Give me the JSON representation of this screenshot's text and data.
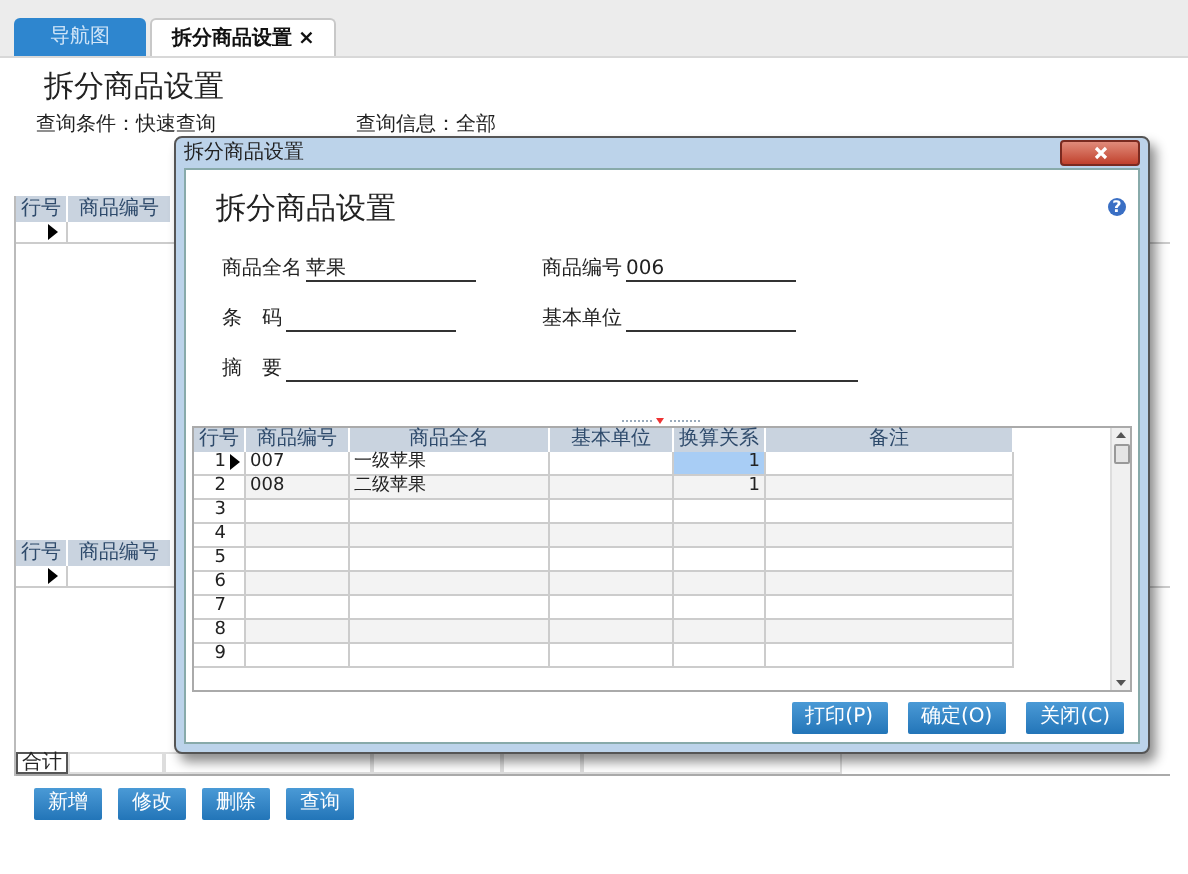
{
  "tabs": [
    {
      "label": "导航图",
      "selected": false
    },
    {
      "label": "拆分商品设置",
      "selected": true,
      "close_glyph": "×"
    }
  ],
  "page_title": "拆分商品设置",
  "query": [
    {
      "label": "查询条件：",
      "value": "快速查询"
    },
    {
      "label": "查询信息：",
      "value": "全部"
    }
  ],
  "upper_grid": {
    "columns": [
      "行号",
      "商品编号"
    ],
    "rows": [
      {
        "selected": true
      }
    ]
  },
  "lower_grid": {
    "columns": [
      "行号",
      "商品编号"
    ],
    "rows": [
      {
        "selected": true
      }
    ]
  },
  "total_label": "合计",
  "buttons": [
    "新增",
    "修改",
    "删除",
    "查询"
  ],
  "dialog": {
    "title": "拆分商品设置",
    "heading": "拆分商品设置",
    "help_glyph": "?",
    "fields": [
      {
        "label": "商品全名",
        "value": "苹果"
      },
      {
        "label": "商品编号",
        "value": "006"
      },
      {
        "label": "条　码"
      },
      {
        "label": "基本单位"
      },
      {
        "label": "摘　要"
      }
    ],
    "grid": {
      "columns": [
        "行号",
        "商品编号",
        "商品全名",
        "基本单位",
        "换算关系",
        "备注"
      ],
      "rows": [
        {
          "no": "1",
          "code": "007",
          "name": "一级苹果",
          "ratio": "1",
          "selected": true
        },
        {
          "no": "2",
          "code": "008",
          "name": "二级苹果",
          "ratio": "1",
          "selected": false
        },
        {
          "no": "3",
          "selected": false
        },
        {
          "no": "4",
          "selected": false
        },
        {
          "no": "5",
          "selected": false
        },
        {
          "no": "6",
          "selected": false
        },
        {
          "no": "7",
          "selected": false
        },
        {
          "no": "8",
          "selected": false
        },
        {
          "no": "9",
          "selected": false
        }
      ]
    },
    "buttons": [
      "打印(P)",
      "确定(O)",
      "关闭(C)"
    ]
  }
}
